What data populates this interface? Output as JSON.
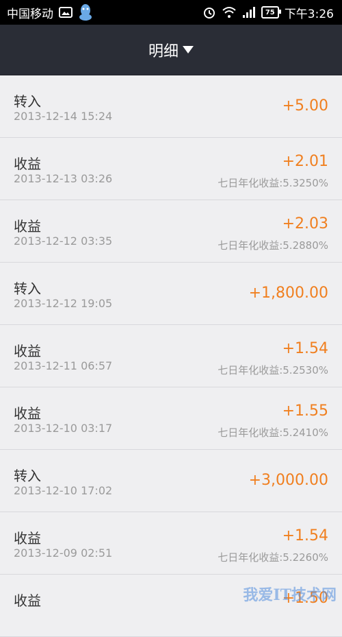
{
  "status_bar": {
    "carrier": "中国移动",
    "battery": "75",
    "time": "下午3:26"
  },
  "header": {
    "title": "明细"
  },
  "entries": [
    {
      "title": "转入",
      "date": "2013-12-14 15:24",
      "amount": "+5.00",
      "rate": ""
    },
    {
      "title": "收益",
      "date": "2013-12-13 03:26",
      "amount": "+2.01",
      "rate": "七日年化收益:5.3250%"
    },
    {
      "title": "收益",
      "date": "2013-12-12 03:35",
      "amount": "+2.03",
      "rate": "七日年化收益:5.2880%"
    },
    {
      "title": "转入",
      "date": "2013-12-12 19:05",
      "amount": "+1,800.00",
      "rate": ""
    },
    {
      "title": "收益",
      "date": "2013-12-11 06:57",
      "amount": "+1.54",
      "rate": "七日年化收益:5.2530%"
    },
    {
      "title": "收益",
      "date": "2013-12-10 03:17",
      "amount": "+1.55",
      "rate": "七日年化收益:5.2410%"
    },
    {
      "title": "转入",
      "date": "2013-12-10 17:02",
      "amount": "+3,000.00",
      "rate": ""
    },
    {
      "title": "收益",
      "date": "2013-12-09 02:51",
      "amount": "+1.54",
      "rate": "七日年化收益:5.2260%"
    },
    {
      "title": "收益",
      "date": "",
      "amount": "+1.50",
      "rate": ""
    }
  ],
  "watermark": "我爱IT技术网",
  "colors": {
    "accent": "#f07f1f",
    "header_bg": "#2a2d36",
    "list_bg": "#efeff1"
  },
  "icons": [
    "image-icon",
    "qq-icon",
    "alarm-icon",
    "wifi-icon",
    "signal-icon",
    "battery-icon",
    "dropdown-triangle-icon"
  ]
}
